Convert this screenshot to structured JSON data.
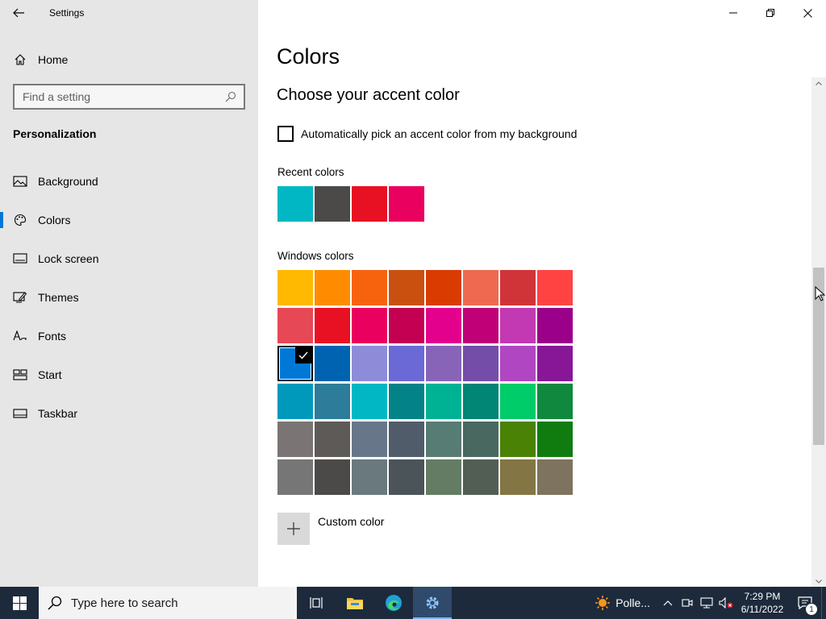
{
  "window": {
    "title": "Settings"
  },
  "sidebar": {
    "home_label": "Home",
    "search_placeholder": "Find a setting",
    "section_title": "Personalization",
    "items": [
      {
        "label": "Background",
        "icon": "picture-icon",
        "active": false
      },
      {
        "label": "Colors",
        "icon": "palette-icon",
        "active": true
      },
      {
        "label": "Lock screen",
        "icon": "lock-screen-icon",
        "active": false
      },
      {
        "label": "Themes",
        "icon": "themes-icon",
        "active": false
      },
      {
        "label": "Fonts",
        "icon": "fonts-icon",
        "active": false
      },
      {
        "label": "Start",
        "icon": "start-icon",
        "active": false
      },
      {
        "label": "Taskbar",
        "icon": "taskbar-icon",
        "active": false
      }
    ]
  },
  "main": {
    "title": "Colors",
    "subtitle": "Choose your accent color",
    "auto_pick_label": "Automatically pick an accent color from my background",
    "auto_pick_checked": false,
    "recent_label": "Recent colors",
    "recent_colors": [
      "#00b7c3",
      "#4c4a48",
      "#e81123",
      "#ea005e"
    ],
    "windows_label": "Windows colors",
    "windows_colors": [
      [
        "#ffb900",
        "#ff8c00",
        "#f7630c",
        "#ca5010",
        "#da3b01",
        "#ef6950",
        "#d13438",
        "#ff4343"
      ],
      [
        "#e74856",
        "#e81123",
        "#ea005e",
        "#c30052",
        "#e3008c",
        "#bf0077",
        "#c239b3",
        "#9a0089"
      ],
      [
        "#0078d7",
        "#0063b1",
        "#8e8cd8",
        "#6b69d6",
        "#8764b8",
        "#744da9",
        "#b146c2",
        "#881798"
      ],
      [
        "#0099bc",
        "#2d7d9a",
        "#00b7c3",
        "#038387",
        "#00b294",
        "#018574",
        "#00cc6a",
        "#10893e"
      ],
      [
        "#7a7574",
        "#5d5a58",
        "#68768a",
        "#515c6b",
        "#567c73",
        "#486860",
        "#498205",
        "#107c10"
      ],
      [
        "#767676",
        "#4c4a48",
        "#69797e",
        "#4a5459",
        "#647c64",
        "#525e54",
        "#847545",
        "#7e735f"
      ]
    ],
    "selected": {
      "row": 2,
      "col": 0
    },
    "custom_label": "Custom color"
  },
  "taskbar": {
    "search_placeholder": "Type here to search",
    "weather_label": "Polle...",
    "time": "7:29 PM",
    "date": "6/11/2022",
    "notification_count": "1"
  }
}
